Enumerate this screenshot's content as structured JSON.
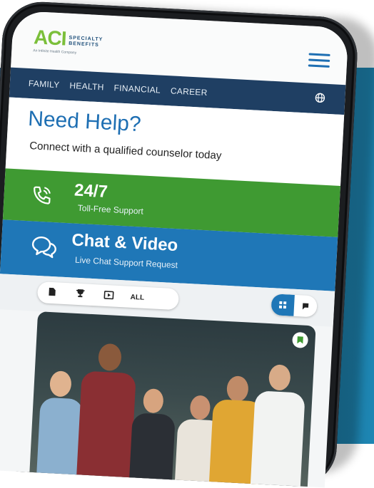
{
  "logo": {
    "mark": "ACI",
    "subtitle_line1": "SPECIALTY",
    "subtitle_line2": "BENEFITS",
    "tagline": "An Infinite Health Company"
  },
  "nav": {
    "items": [
      "FAMILY",
      "HEALTH",
      "FINANCIAL",
      "CAREER"
    ]
  },
  "help": {
    "title": "Need Help?",
    "subtitle": "Connect with a qualified counselor today"
  },
  "support": {
    "title": "24/7",
    "subtitle": "Toll-Free Support"
  },
  "chat": {
    "title": "Chat & Video",
    "subtitle": "Live Chat Support Request"
  },
  "filters": {
    "all_label": "ALL"
  },
  "colors": {
    "brand_blue": "#1e6fb3",
    "nav_navy": "#1f3f63",
    "support_green": "#3f9a32",
    "chat_blue": "#1f77b7",
    "logo_green": "#7bbf3a"
  }
}
